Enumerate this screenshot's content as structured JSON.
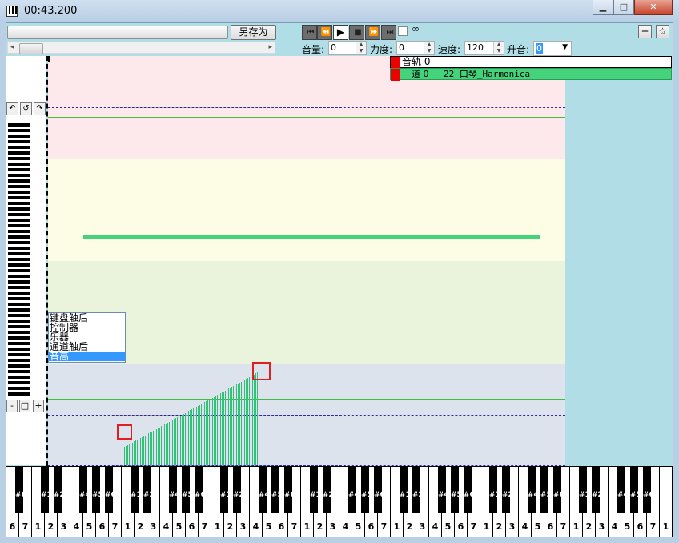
{
  "window": {
    "title": "00:43.200",
    "minimize": "▁",
    "maximize": "□",
    "close": "✕"
  },
  "toolbar": {
    "save_as_label": "另存为",
    "loop_symbol": "∞",
    "add_label": "+",
    "star_label": "☆",
    "transport": {
      "first": "⏮",
      "prev": "⏪",
      "play": "▶",
      "stop": "■",
      "next": "⏩",
      "last": "⏭"
    },
    "volume": {
      "label": "音量:",
      "value": "0"
    },
    "velocity": {
      "label": "力度:",
      "value": "0"
    },
    "speed": {
      "label": "速度:",
      "value": "120"
    },
    "transpose": {
      "label": "升音:",
      "value": "0"
    }
  },
  "track_panel": {
    "track_label": "音轨 0",
    "channel_label": "道 0",
    "instrument": "22 口琴_Harmonica"
  },
  "context_menu": {
    "items": [
      "键盘触后",
      "控制器",
      "乐器",
      "通道触后",
      "音高"
    ],
    "selected": "音高"
  },
  "sidebar": {
    "undo": "↶",
    "refresh": "↺",
    "redo": "↷",
    "zoom_out": "-",
    "zoom_fit": "□",
    "zoom_in": "+"
  },
  "colors": {
    "note_bar": "#44d27a",
    "velocity": "#33c07a",
    "track_red": "#e00000",
    "selection": "#3399ff"
  },
  "velocity_ramp": {
    "start": 0.18,
    "end": 0.97
  },
  "keyboard_notes": {
    "white_labels": [
      "6",
      "7",
      "1",
      "2",
      "3",
      "4",
      "5",
      "6",
      "7"
    ],
    "black_pattern": [
      "#6",
      "#1",
      "#2",
      "#4",
      "#5",
      "#6"
    ]
  }
}
